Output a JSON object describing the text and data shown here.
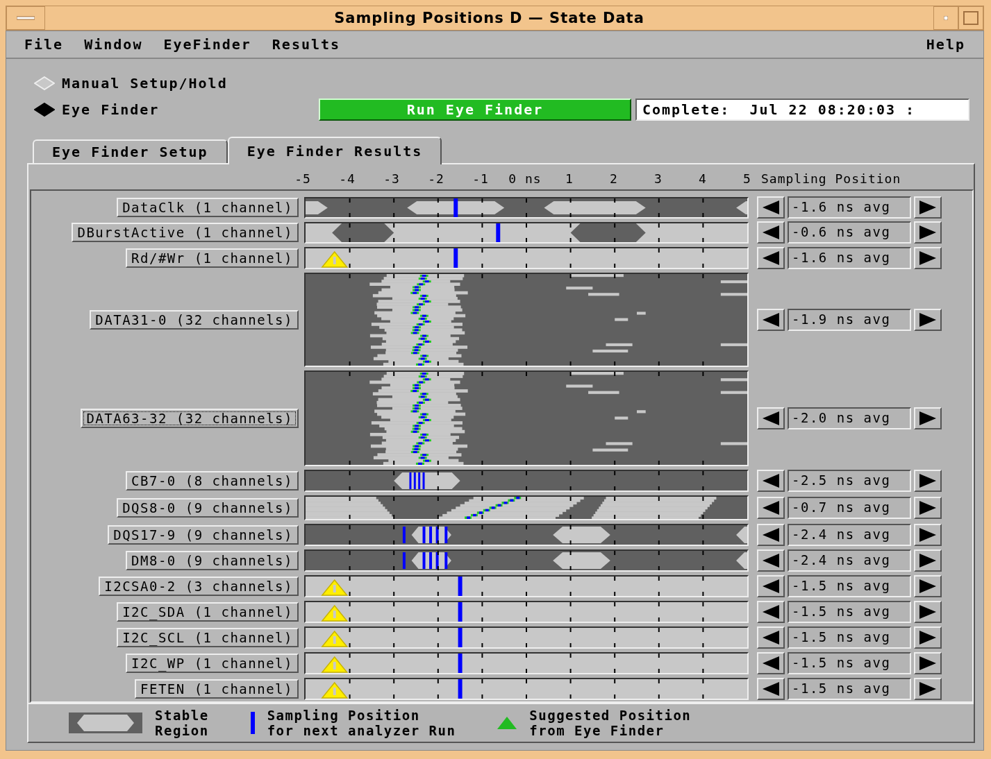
{
  "window": {
    "title": "Sampling Positions D — State Data"
  },
  "menu": {
    "left": [
      "File",
      "Window",
      "EyeFinder",
      "Results"
    ],
    "right": [
      "Help"
    ]
  },
  "modes": [
    {
      "label": "Manual Setup/Hold",
      "selected": false
    },
    {
      "label": "Eye Finder",
      "selected": true
    }
  ],
  "run_button": "Run Eye Finder",
  "status": "Complete:  Jul 22 08:20:03 :",
  "tabs": [
    {
      "label": "Eye Finder Setup",
      "selected": false
    },
    {
      "label": "Eye Finder Results",
      "selected": true
    }
  ],
  "axis": {
    "ticks": [
      "-5",
      "-4",
      "-3",
      "-2",
      "-1",
      "0 ns",
      "1",
      "2",
      "3",
      "4",
      "5"
    ],
    "title": "Sampling Position"
  },
  "rows": [
    {
      "label": "DataClk (1 channel)",
      "kind": "clock",
      "level": 0.34,
      "warning": false,
      "focused": false,
      "reading": "-1.6 ns avg"
    },
    {
      "label": "DBurstActive (1 channel)",
      "kind": "burst",
      "level": 0.436,
      "warning": false,
      "focused": false,
      "reading": "-0.6 ns avg"
    },
    {
      "label": "Rd/#Wr (1 channel)",
      "kind": "flat",
      "level": 0.34,
      "warning": true,
      "focused": false,
      "reading": "-1.6 ns avg"
    },
    {
      "label": "DATA31-0 (32 channels)",
      "kind": "bus",
      "warning": false,
      "focused": false,
      "reading": "-1.9 ns avg"
    },
    {
      "label": "DATA63-32 (32 channels)",
      "kind": "bus",
      "warning": false,
      "focused": true,
      "reading": "-2.0 ns avg"
    },
    {
      "label": "CB7-0 (8 channels)",
      "kind": "cb",
      "warning": false,
      "focused": false,
      "reading": "-2.5 ns avg"
    },
    {
      "label": "DQS8-0 (9 channels)",
      "kind": "dqs",
      "warning": false,
      "focused": false,
      "reading": "-0.7 ns avg"
    },
    {
      "label": "DQS17-9 (9 channels)",
      "kind": "strobe",
      "warning": false,
      "focused": false,
      "reading": "-2.4 ns avg"
    },
    {
      "label": "DM8-0 (9 channels)",
      "kind": "strobe",
      "warning": false,
      "focused": false,
      "reading": "-2.4 ns avg"
    },
    {
      "label": "I2CSA0-2 (3 channels)",
      "kind": "flat",
      "level": 0.35,
      "warning": true,
      "focused": false,
      "reading": "-1.5 ns avg"
    },
    {
      "label": "I2C_SDA (1 channel)",
      "kind": "flat",
      "level": 0.35,
      "warning": true,
      "focused": false,
      "reading": "-1.5 ns avg"
    },
    {
      "label": "I2C_SCL (1 channel)",
      "kind": "flat",
      "level": 0.35,
      "warning": true,
      "focused": false,
      "reading": "-1.5 ns avg"
    },
    {
      "label": "I2C_WP (1 channel)",
      "kind": "flat",
      "level": 0.35,
      "warning": true,
      "focused": false,
      "reading": "-1.5 ns avg"
    },
    {
      "label": "FETEN (1 channel)",
      "kind": "flat",
      "level": 0.35,
      "warning": true,
      "focused": false,
      "reading": "-1.5 ns avg"
    }
  ],
  "legend": [
    {
      "kind": "stable",
      "lines": [
        "Stable",
        "Region"
      ]
    },
    {
      "kind": "sampling",
      "lines": [
        "Sampling Position",
        "for next analyzer Run"
      ]
    },
    {
      "kind": "suggested",
      "lines": [
        "Suggested Position",
        "from Eye Finder"
      ]
    }
  ]
}
